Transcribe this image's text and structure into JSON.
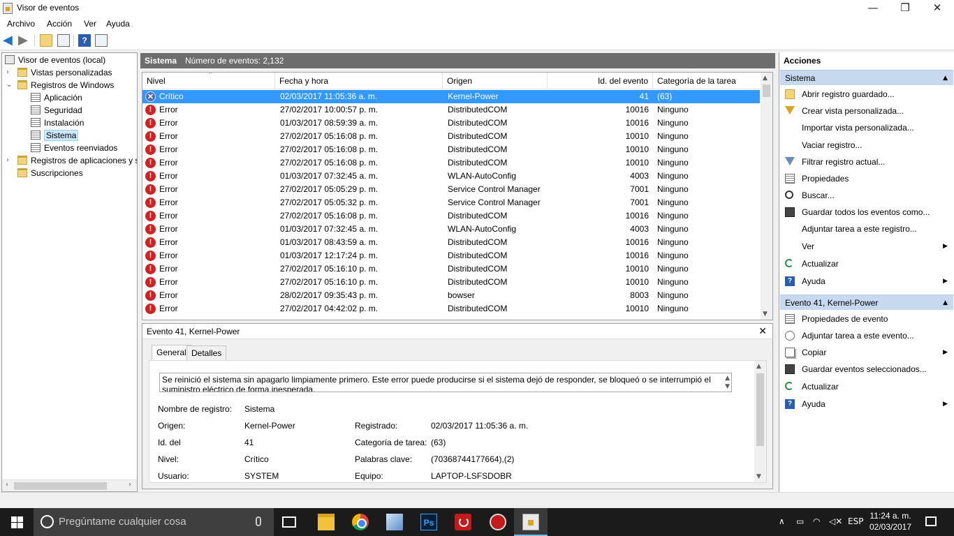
{
  "window": {
    "title": "Visor de eventos",
    "controls": {
      "minimize": "—",
      "maximize": "❐",
      "close": "✕"
    }
  },
  "menu": [
    "Archivo",
    "Acción",
    "Ver",
    "Ayuda"
  ],
  "tree": {
    "root": "Visor de eventos (local)",
    "items": [
      {
        "label": "Vistas personalizadas",
        "icon": "folder-icon"
      },
      {
        "label": "Registros de Windows",
        "icon": "folder-icon"
      },
      {
        "label": "Aplicación",
        "icon": "log-icon"
      },
      {
        "label": "Seguridad",
        "icon": "log-icon"
      },
      {
        "label": "Instalación",
        "icon": "log-icon"
      },
      {
        "label": "Sistema",
        "icon": "log-icon",
        "selected": true
      },
      {
        "label": "Eventos reenviados",
        "icon": "log-icon"
      },
      {
        "label": "Registros de aplicaciones y s",
        "icon": "folder-icon"
      },
      {
        "label": "Suscripciones",
        "icon": "folder-icon"
      }
    ]
  },
  "center": {
    "title": "Sistema",
    "count_label": "Número de eventos: 2,132"
  },
  "grid": {
    "columns": [
      "Nivel",
      "Fecha y hora",
      "Origen",
      "Id. del evento",
      "Categoría de la tarea"
    ],
    "rows": [
      {
        "level": "Crítico",
        "date": "02/03/2017 11:05:36 a. m.",
        "source": "Kernel-Power",
        "id": "41",
        "category": "(63)",
        "selected": true
      },
      {
        "level": "Error",
        "date": "27/02/2017 10:00:57 p. m.",
        "source": "DistributedCOM",
        "id": "10016",
        "category": "Ninguno"
      },
      {
        "level": "Error",
        "date": "01/03/2017 08:59:39 a. m.",
        "source": "DistributedCOM",
        "id": "10016",
        "category": "Ninguno"
      },
      {
        "level": "Error",
        "date": "27/02/2017 05:16:08 p. m.",
        "source": "DistributedCOM",
        "id": "10010",
        "category": "Ninguno"
      },
      {
        "level": "Error",
        "date": "27/02/2017 05:16:08 p. m.",
        "source": "DistributedCOM",
        "id": "10010",
        "category": "Ninguno"
      },
      {
        "level": "Error",
        "date": "27/02/2017 05:16:08 p. m.",
        "source": "DistributedCOM",
        "id": "10010",
        "category": "Ninguno"
      },
      {
        "level": "Error",
        "date": "01/03/2017 07:32:45 a. m.",
        "source": "WLAN-AutoConfig",
        "id": "4003",
        "category": "Ninguno"
      },
      {
        "level": "Error",
        "date": "27/02/2017 05:05:29 p. m.",
        "source": "Service Control Manager",
        "id": "7001",
        "category": "Ninguno"
      },
      {
        "level": "Error",
        "date": "27/02/2017 05:05:32 p. m.",
        "source": "Service Control Manager",
        "id": "7001",
        "category": "Ninguno"
      },
      {
        "level": "Error",
        "date": "27/02/2017 05:16:08 p. m.",
        "source": "DistributedCOM",
        "id": "10016",
        "category": "Ninguno"
      },
      {
        "level": "Error",
        "date": "01/03/2017 07:32:45 a. m.",
        "source": "WLAN-AutoConfig",
        "id": "4003",
        "category": "Ninguno"
      },
      {
        "level": "Error",
        "date": "01/03/2017 08:43:59 a. m.",
        "source": "DistributedCOM",
        "id": "10016",
        "category": "Ninguno"
      },
      {
        "level": "Error",
        "date": "01/03/2017 12:17:24 p. m.",
        "source": "DistributedCOM",
        "id": "10016",
        "category": "Ninguno"
      },
      {
        "level": "Error",
        "date": "27/02/2017 05:16:10 p. m.",
        "source": "DistributedCOM",
        "id": "10010",
        "category": "Ninguno"
      },
      {
        "level": "Error",
        "date": "27/02/2017 05:16:10 p. m.",
        "source": "DistributedCOM",
        "id": "10010",
        "category": "Ninguno"
      },
      {
        "level": "Error",
        "date": "28/02/2017 09:35:43 p. m.",
        "source": "bowser",
        "id": "8003",
        "category": "Ninguno"
      },
      {
        "level": "Error",
        "date": "27/02/2017 04:42:02 p. m.",
        "source": "DistributedCOM",
        "id": "10010",
        "category": "Ninguno"
      }
    ]
  },
  "detail": {
    "title": "Evento 41, Kernel-Power",
    "tabs": [
      "General",
      "Detalles"
    ],
    "description": "Se reinició el sistema sin apagarlo limpiamente primero. Este error puede producirse si el sistema dejó de responder, se bloqueó o se interrumpió el suministro eléctrico de forma inesperada.",
    "fields": {
      "log_name_label": "Nombre de registro:",
      "log_name": "Sistema",
      "source_label": "Origen:",
      "source": "Kernel-Power",
      "logged_label": "Registrado:",
      "logged": "02/03/2017 11:05:36 a. m.",
      "event_id_label": "Id. del",
      "event_id": "41",
      "task_label": "Categoría de tarea:",
      "task": "(63)",
      "level_label": "Nivel:",
      "level": "Crítico",
      "keywords_label": "Palabras clave:",
      "keywords": "(70368744177664),(2)",
      "user_label": "Usuario:",
      "user": "SYSTEM",
      "computer_label": "Equipo:",
      "computer": "LAPTOP-LSFSDOBR"
    }
  },
  "actions": {
    "title": "Acciones",
    "section1": "Sistema",
    "items1": [
      {
        "label": "Abrir registro guardado...",
        "icon": "open-log-icon"
      },
      {
        "label": "Crear vista personalizada...",
        "icon": "filter-icon"
      },
      {
        "label": "Importar vista personalizada...",
        "icon": ""
      },
      {
        "label": "Vaciar registro...",
        "icon": ""
      },
      {
        "label": "Filtrar registro actual...",
        "icon": "filter-icon"
      },
      {
        "label": "Propiedades",
        "icon": "properties-icon"
      },
      {
        "label": "Buscar...",
        "icon": "find-icon"
      },
      {
        "label": "Guardar todos los eventos como...",
        "icon": "save-icon"
      },
      {
        "label": "Adjuntar tarea a este registro...",
        "icon": ""
      },
      {
        "label": "Ver",
        "icon": "",
        "submenu": true
      },
      {
        "label": "Actualizar",
        "icon": "refresh-icon"
      },
      {
        "label": "Ayuda",
        "icon": "help-icon",
        "submenu": true
      }
    ],
    "section2": "Evento 41, Kernel-Power",
    "items2": [
      {
        "label": "Propiedades de evento",
        "icon": "properties-icon"
      },
      {
        "label": "Adjuntar tarea a este evento...",
        "icon": "task-icon"
      },
      {
        "label": "Copiar",
        "icon": "copy-icon",
        "submenu": true
      },
      {
        "label": "Guardar eventos seleccionados...",
        "icon": "save-icon"
      },
      {
        "label": "Actualizar",
        "icon": "refresh-icon"
      },
      {
        "label": "Ayuda",
        "icon": "help-icon",
        "submenu": true
      }
    ]
  },
  "taskbar": {
    "search_placeholder": "Pregúntame cualquier cosa",
    "language": "ESP",
    "time": "11:24 a. m.",
    "date": "02/03/2017"
  }
}
